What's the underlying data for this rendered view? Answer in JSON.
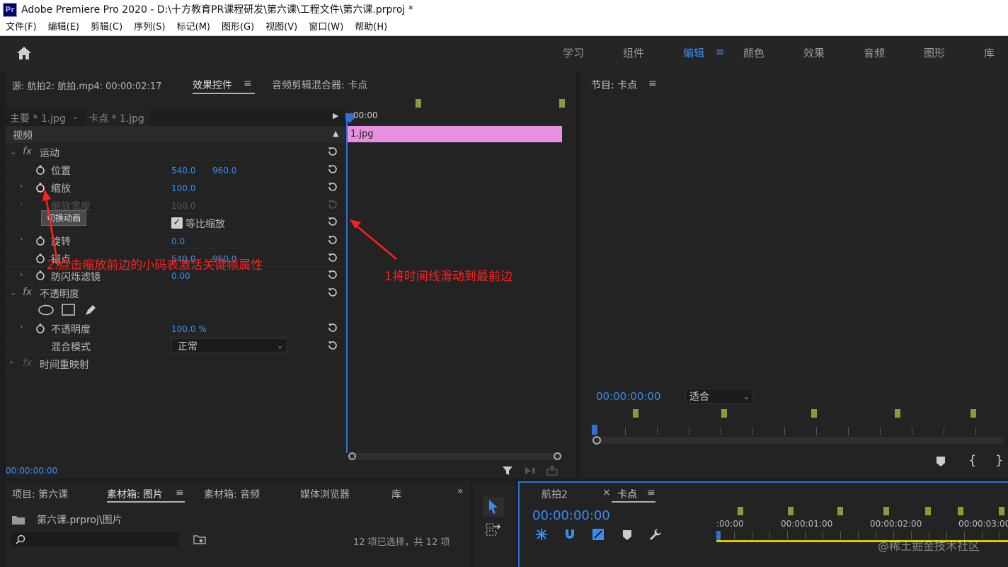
{
  "app": {
    "logo": "Pr",
    "title": "Adobe Premiere Pro 2020 - D:\\十方教育PR课程研发\\第六课\\工程文件\\第六课.prproj *"
  },
  "menu": [
    "文件(F)",
    "编辑(E)",
    "剪辑(C)",
    "序列(S)",
    "标记(M)",
    "图形(G)",
    "视图(V)",
    "窗口(W)",
    "帮助(H)"
  ],
  "workspaces": [
    "学习",
    "组件",
    "编辑",
    "颜色",
    "效果",
    "音频",
    "图形",
    "库"
  ],
  "source_panel": {
    "tab_source": "源: 航拍2: 航拍.mp4: 00:00:02:17",
    "tab_effects": "效果控件",
    "tab_audio_mixer": "音频剪辑混合器: 卡点",
    "master_clip": "主要 * 1.jpg",
    "seq_clip": "卡点 * 1.jpg",
    "section_video": "视频",
    "motion": "运动",
    "position": "位置",
    "position_x": "540.0",
    "position_y": "960.0",
    "scale": "缩放",
    "scale_val": "100.0",
    "scale_width": "缩放宽度",
    "scale_width_val": "100.0",
    "tooltip": "切换动画",
    "uniform_scale": "等比缩放",
    "rotation": "旋转",
    "rotation_val": "0.0",
    "anchor": "锚点",
    "anchor_x": "540.0",
    "anchor_y": "960.0",
    "antiflicker": "防闪烁滤镜",
    "antiflicker_val": "0.00",
    "opacity_group": "不透明度",
    "opacity": "不透明度",
    "opacity_val": "100.0 %",
    "blend_mode": "混合模式",
    "blend_val": "正常",
    "time_remap": "时间重映射",
    "timecode": "00:00:00:00",
    "mini_time": ":00:00",
    "clip_name": "1.jpg"
  },
  "annotations": {
    "step2": "2.点击缩放前边的小码表激活关键帧属性",
    "step1": "1将时间线滑动到最前边"
  },
  "program_panel": {
    "title": "节目: 卡点",
    "timecode": "00:00:00:00",
    "fit": "适合"
  },
  "project_panel": {
    "tabs": [
      "项目: 第六课",
      "素材箱: 图片",
      "素材箱: 音频",
      "媒体浏览器",
      "库"
    ],
    "path": "第六课.prproj\\图片",
    "status": "12 项已选择，共 12 项"
  },
  "timeline_panel": {
    "tab1": "航拍2",
    "tab2": "卡点",
    "timecode": "00:00:00:00",
    "ruler": [
      ":00:00",
      "00:00:01:00",
      "00:00:02:00",
      "00:00:03:00"
    ]
  },
  "watermark": "@稀土掘金技术社区",
  "colors": {
    "accent_blue": "#3a8df0",
    "clip_pink": "#e890e0",
    "annotation_red": "#ff2020",
    "keyframe_olive": "#8a9a3a"
  }
}
